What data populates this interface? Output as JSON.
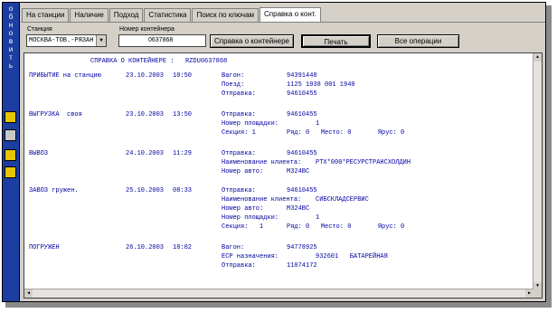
{
  "sidebar": {
    "vertical_text": [
      "о",
      "б",
      "н",
      "о",
      "в",
      "и",
      "т",
      "ь"
    ]
  },
  "tabs": [
    "На станции",
    "Наличие",
    "Подход",
    "Статистика",
    "Поиск по ключам",
    "Справка о конт."
  ],
  "station": {
    "label": "Станция",
    "value": "МОСКВА-ТОВ.-РЯЗАН"
  },
  "container": {
    "label": "Номер контейнера",
    "value": "0637868"
  },
  "buttons": {
    "info": "Справка о контейнере",
    "print": "Печать",
    "all_ops": "Все операции"
  },
  "report": {
    "header": "СПРАВКА О КОНТЕЙНЕРЕ :   RZDU0637868",
    "events": [
      {
        "op": "ПРИБЫТИЕ на станцию",
        "date": "23.10.2003",
        "time": "10:50",
        "lines": [
          [
            "Вагон:",
            "94391448"
          ],
          [
            "Поезд:",
            "1125 1938 001 1940"
          ],
          [
            "Отправка:",
            "94610455"
          ]
        ]
      },
      {
        "op": "ВЫГРУЗКА  своя",
        "date": "23.10.2003",
        "time": "13:50",
        "lines": [
          [
            "Отправка:",
            "94610455"
          ],
          [
            "Номер площадки:",
            "1"
          ],
          [
            "Секция: 1",
            "Ряд: 0   Место: 0       Ярус: 0"
          ]
        ]
      },
      {
        "op": "ВЫВОЗ",
        "date": "24.10.2003",
        "time": "11:29",
        "lines": [
          [
            "Отправка:",
            "94610455"
          ],
          [
            "Наименование клиента:",
            "РТХ*000*РЕСУРСТРАНСХОЛДИН"
          ],
          [
            "Номер авто:",
            "М324ВС"
          ]
        ]
      },
      {
        "op": "ЗАВОЗ гружен.",
        "date": "25.10.2003",
        "time": "08:33",
        "lines": [
          [
            "Отправка:",
            "94610455"
          ],
          [
            "Наименование клиента:",
            "СИБСКЛАДСЕРВИС"
          ],
          [
            "Номер авто:",
            "М324ВС"
          ],
          [
            "Номер площадки:",
            "1"
          ],
          [
            "Секция:   1",
            "Ряд: 0   Место: 0       Ярус: 0"
          ]
        ]
      },
      {
        "op": "ПОГРУЖЕН",
        "date": "26.10.2003",
        "time": "18:02",
        "lines": [
          [
            "Вагон:",
            "94778925"
          ],
          [
            "ЕСР назначения:",
            "932601   БАТАРЕЙНАЯ"
          ],
          [
            "Отправка:",
            "11074172"
          ]
        ]
      }
    ]
  }
}
